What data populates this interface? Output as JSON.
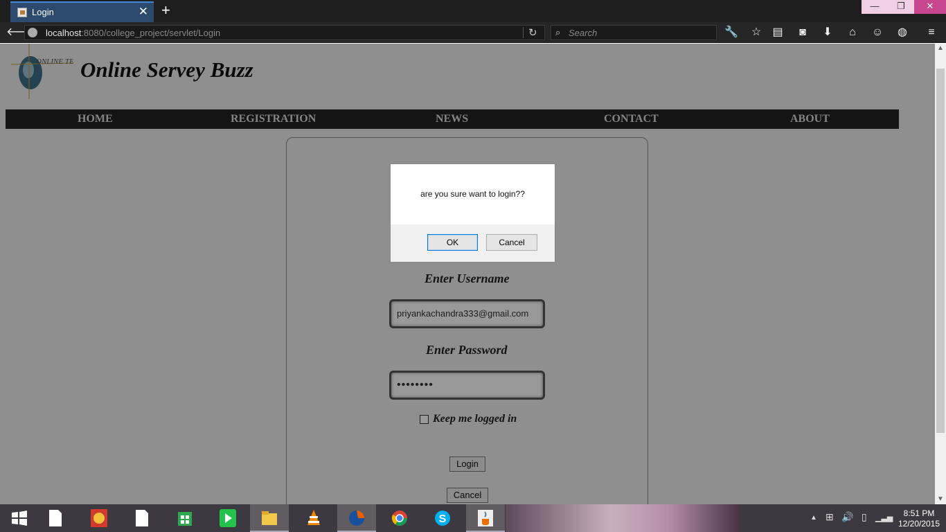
{
  "browser": {
    "tab_title": "Login",
    "url_host": "localhost",
    "url_rest": ":8080/college_project/servlet/Login",
    "search_placeholder": "Search"
  },
  "site": {
    "logo_text": "ONLINE TEST",
    "title": "Online Servey Buzz",
    "menu": [
      "HOME",
      "REGISTRATION",
      "NEWS",
      "CONTACT",
      "ABOUT"
    ]
  },
  "form": {
    "username_label": "Enter Username",
    "username_value": "priyankachandra333@gmail.com",
    "password_label": "Enter Password",
    "password_value": "••••••••",
    "keep_logged_in": "Keep me logged in",
    "login_button": "Login",
    "cancel_button": "Cancel"
  },
  "dialog": {
    "message": "are you sure want to login??",
    "ok": "OK",
    "cancel": "Cancel"
  },
  "taskbar": {
    "time": "8:51 PM",
    "date": "12/20/2015"
  }
}
